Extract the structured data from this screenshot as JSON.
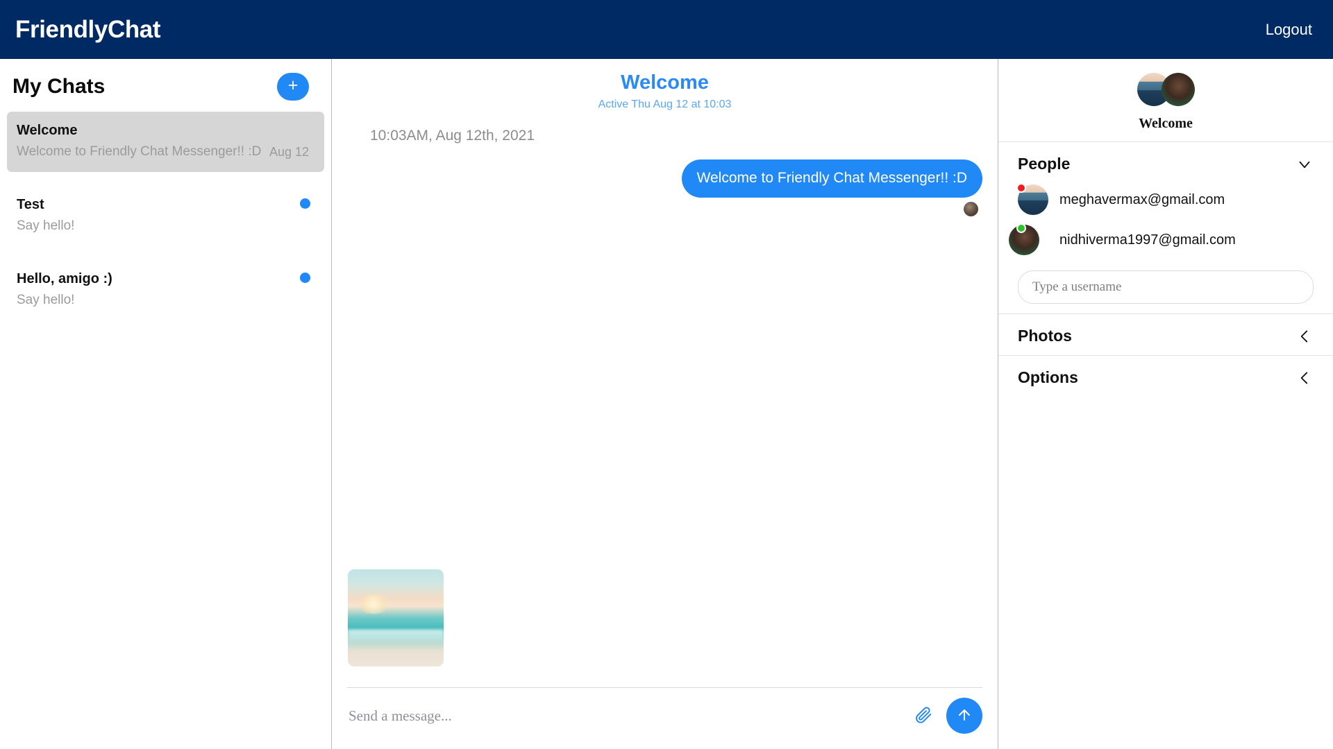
{
  "header": {
    "brand": "FriendlyChat",
    "logout_label": "Logout"
  },
  "sidebar": {
    "title": "My Chats",
    "add_button_label": "+",
    "chats": [
      {
        "name": "Welcome",
        "preview": "Welcome to Friendly Chat Messenger!! :D",
        "date": "Aug 12",
        "selected": true,
        "unread": false
      },
      {
        "name": "Test",
        "preview": "Say hello!",
        "date": "",
        "selected": false,
        "unread": true
      },
      {
        "name": "Hello, amigo :)",
        "preview": "Say hello!",
        "date": "",
        "selected": false,
        "unread": true
      }
    ]
  },
  "conversation": {
    "title": "Welcome",
    "active_status": "Active Thu Aug 12 at 10:03",
    "timestamp": "10:03AM, Aug 12th, 2021",
    "messages": [
      {
        "text": "Welcome to Friendly Chat Messenger!! :D",
        "outgoing": true
      }
    ]
  },
  "composer": {
    "placeholder": "Send a message...",
    "value": "",
    "attachment_label": "beach-sunset-photo",
    "attach_icon": "paperclip-icon",
    "send_icon": "arrow-up-icon"
  },
  "right_panel": {
    "group_name": "Welcome",
    "sections": [
      {
        "title": "People",
        "chevron": "chevron-down-icon",
        "expanded": true
      },
      {
        "title": "Photos",
        "chevron": "chevron-left-icon",
        "expanded": false
      },
      {
        "title": "Options",
        "chevron": "chevron-left-icon",
        "expanded": false
      }
    ],
    "people": [
      {
        "email": "meghavermax@gmail.com",
        "status": "offline"
      },
      {
        "email": "nidhiverma1997@gmail.com",
        "status": "online"
      }
    ],
    "username_placeholder": "Type a username",
    "username_value": ""
  },
  "colors": {
    "header_navy": "#002a63",
    "accent_blue": "#2189f5",
    "title_blue": "#2a8bf4",
    "subtitle_blue": "#5aa6f7",
    "selected_row": "#d6d6d6",
    "muted_text": "#9b9b9b",
    "status_online": "#2fc22f",
    "status_offline": "#ef1d1d"
  }
}
